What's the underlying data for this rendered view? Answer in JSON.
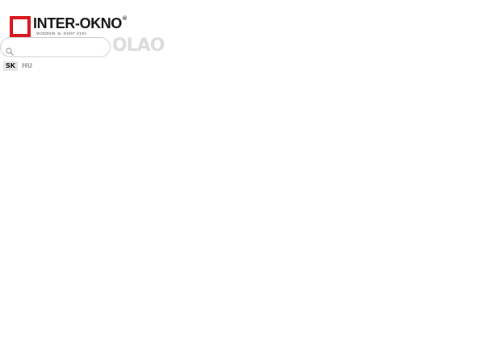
{
  "header": {
    "logo": {
      "name": "INTER-OKNO",
      "registered": "®",
      "tagline": "window & door syst"
    },
    "brand_color": "#d9161c",
    "search": {
      "icon": "search-icon",
      "placeholder": "",
      "value": ""
    },
    "ghost_heading": "OLAO"
  },
  "languages": [
    {
      "label": "SK",
      "active": true
    },
    {
      "label": "HU",
      "active": false
    }
  ]
}
